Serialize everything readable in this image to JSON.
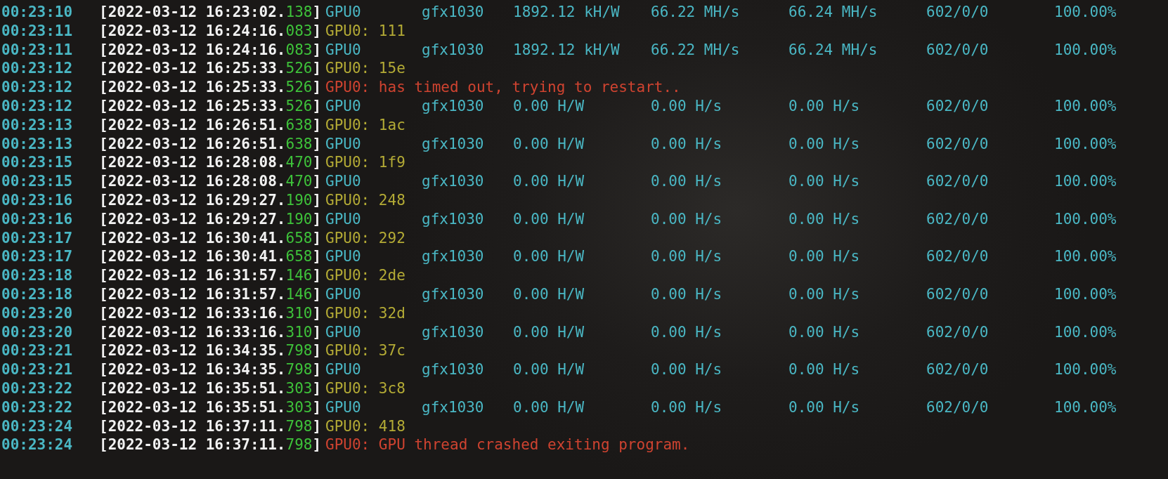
{
  "lines": [
    {
      "time": "00:23:10",
      "stamp": "[2022-03-12 16:23:02.",
      "ms": "138",
      "bracket": "]",
      "kind": "stats",
      "device": "GPU0",
      "model": "gfx1030",
      "efficiency": "1892.12 kH/W",
      "hashrate": "66.22 MH/s",
      "hashrate_avg": "66.24 MH/s",
      "shares": "602/0/0",
      "percent": "100.00%"
    },
    {
      "time": "00:23:11",
      "stamp": "[2022-03-12 16:24:16.",
      "ms": "083",
      "bracket": "]",
      "kind": "info",
      "message": "GPU0: 111"
    },
    {
      "time": "00:23:11",
      "stamp": "[2022-03-12 16:24:16.",
      "ms": "083",
      "bracket": "]",
      "kind": "stats",
      "device": "GPU0",
      "model": "gfx1030",
      "efficiency": "1892.12 kH/W",
      "hashrate": "66.22 MH/s",
      "hashrate_avg": "66.24 MH/s",
      "shares": "602/0/0",
      "percent": "100.00%"
    },
    {
      "time": "00:23:12",
      "stamp": "[2022-03-12 16:25:33.",
      "ms": "526",
      "bracket": "]",
      "kind": "info",
      "message": "GPU0: 15e"
    },
    {
      "time": "00:23:12",
      "stamp": "[2022-03-12 16:25:33.",
      "ms": "526",
      "bracket": "]",
      "kind": "error",
      "message": "GPU0: has timed out, trying to restart.."
    },
    {
      "time": "00:23:12",
      "stamp": "[2022-03-12 16:25:33.",
      "ms": "526",
      "bracket": "]",
      "kind": "stats",
      "device": "GPU0",
      "model": "gfx1030",
      "efficiency": "0.00 H/W",
      "hashrate": "0.00 H/s",
      "hashrate_avg": "0.00 H/s",
      "shares": "602/0/0",
      "percent": "100.00%"
    },
    {
      "time": "00:23:13",
      "stamp": "[2022-03-12 16:26:51.",
      "ms": "638",
      "bracket": "]",
      "kind": "info",
      "message": "GPU0: 1ac"
    },
    {
      "time": "00:23:13",
      "stamp": "[2022-03-12 16:26:51.",
      "ms": "638",
      "bracket": "]",
      "kind": "stats",
      "device": "GPU0",
      "model": "gfx1030",
      "efficiency": "0.00 H/W",
      "hashrate": "0.00 H/s",
      "hashrate_avg": "0.00 H/s",
      "shares": "602/0/0",
      "percent": "100.00%"
    },
    {
      "time": "00:23:15",
      "stamp": "[2022-03-12 16:28:08.",
      "ms": "470",
      "bracket": "]",
      "kind": "info",
      "message": "GPU0: 1f9"
    },
    {
      "time": "00:23:15",
      "stamp": "[2022-03-12 16:28:08.",
      "ms": "470",
      "bracket": "]",
      "kind": "stats",
      "device": "GPU0",
      "model": "gfx1030",
      "efficiency": "0.00 H/W",
      "hashrate": "0.00 H/s",
      "hashrate_avg": "0.00 H/s",
      "shares": "602/0/0",
      "percent": "100.00%"
    },
    {
      "time": "00:23:16",
      "stamp": "[2022-03-12 16:29:27.",
      "ms": "190",
      "bracket": "]",
      "kind": "info",
      "message": "GPU0: 248"
    },
    {
      "time": "00:23:16",
      "stamp": "[2022-03-12 16:29:27.",
      "ms": "190",
      "bracket": "]",
      "kind": "stats",
      "device": "GPU0",
      "model": "gfx1030",
      "efficiency": "0.00 H/W",
      "hashrate": "0.00 H/s",
      "hashrate_avg": "0.00 H/s",
      "shares": "602/0/0",
      "percent": "100.00%"
    },
    {
      "time": "00:23:17",
      "stamp": "[2022-03-12 16:30:41.",
      "ms": "658",
      "bracket": "]",
      "kind": "info",
      "message": "GPU0: 292"
    },
    {
      "time": "00:23:17",
      "stamp": "[2022-03-12 16:30:41.",
      "ms": "658",
      "bracket": "]",
      "kind": "stats",
      "device": "GPU0",
      "model": "gfx1030",
      "efficiency": "0.00 H/W",
      "hashrate": "0.00 H/s",
      "hashrate_avg": "0.00 H/s",
      "shares": "602/0/0",
      "percent": "100.00%"
    },
    {
      "time": "00:23:18",
      "stamp": "[2022-03-12 16:31:57.",
      "ms": "146",
      "bracket": "]",
      "kind": "info",
      "message": "GPU0: 2de"
    },
    {
      "time": "00:23:18",
      "stamp": "[2022-03-12 16:31:57.",
      "ms": "146",
      "bracket": "]",
      "kind": "stats",
      "device": "GPU0",
      "model": "gfx1030",
      "efficiency": "0.00 H/W",
      "hashrate": "0.00 H/s",
      "hashrate_avg": "0.00 H/s",
      "shares": "602/0/0",
      "percent": "100.00%"
    },
    {
      "time": "00:23:20",
      "stamp": "[2022-03-12 16:33:16.",
      "ms": "310",
      "bracket": "]",
      "kind": "info",
      "message": "GPU0: 32d"
    },
    {
      "time": "00:23:20",
      "stamp": "[2022-03-12 16:33:16.",
      "ms": "310",
      "bracket": "]",
      "kind": "stats",
      "device": "GPU0",
      "model": "gfx1030",
      "efficiency": "0.00 H/W",
      "hashrate": "0.00 H/s",
      "hashrate_avg": "0.00 H/s",
      "shares": "602/0/0",
      "percent": "100.00%"
    },
    {
      "time": "00:23:21",
      "stamp": "[2022-03-12 16:34:35.",
      "ms": "798",
      "bracket": "]",
      "kind": "info",
      "message": "GPU0: 37c"
    },
    {
      "time": "00:23:21",
      "stamp": "[2022-03-12 16:34:35.",
      "ms": "798",
      "bracket": "]",
      "kind": "stats",
      "device": "GPU0",
      "model": "gfx1030",
      "efficiency": "0.00 H/W",
      "hashrate": "0.00 H/s",
      "hashrate_avg": "0.00 H/s",
      "shares": "602/0/0",
      "percent": "100.00%"
    },
    {
      "time": "00:23:22",
      "stamp": "[2022-03-12 16:35:51.",
      "ms": "303",
      "bracket": "]",
      "kind": "info",
      "message": "GPU0: 3c8"
    },
    {
      "time": "00:23:22",
      "stamp": "[2022-03-12 16:35:51.",
      "ms": "303",
      "bracket": "]",
      "kind": "stats",
      "device": "GPU0",
      "model": "gfx1030",
      "efficiency": "0.00 H/W",
      "hashrate": "0.00 H/s",
      "hashrate_avg": "0.00 H/s",
      "shares": "602/0/0",
      "percent": "100.00%"
    },
    {
      "time": "00:23:24",
      "stamp": "[2022-03-12 16:37:11.",
      "ms": "798",
      "bracket": "]",
      "kind": "info",
      "message": "GPU0: 418"
    },
    {
      "time": "00:23:24",
      "stamp": "[2022-03-12 16:37:11.",
      "ms": "798",
      "bracket": "]",
      "kind": "error",
      "message": "GPU0: GPU thread crashed exiting program."
    }
  ]
}
